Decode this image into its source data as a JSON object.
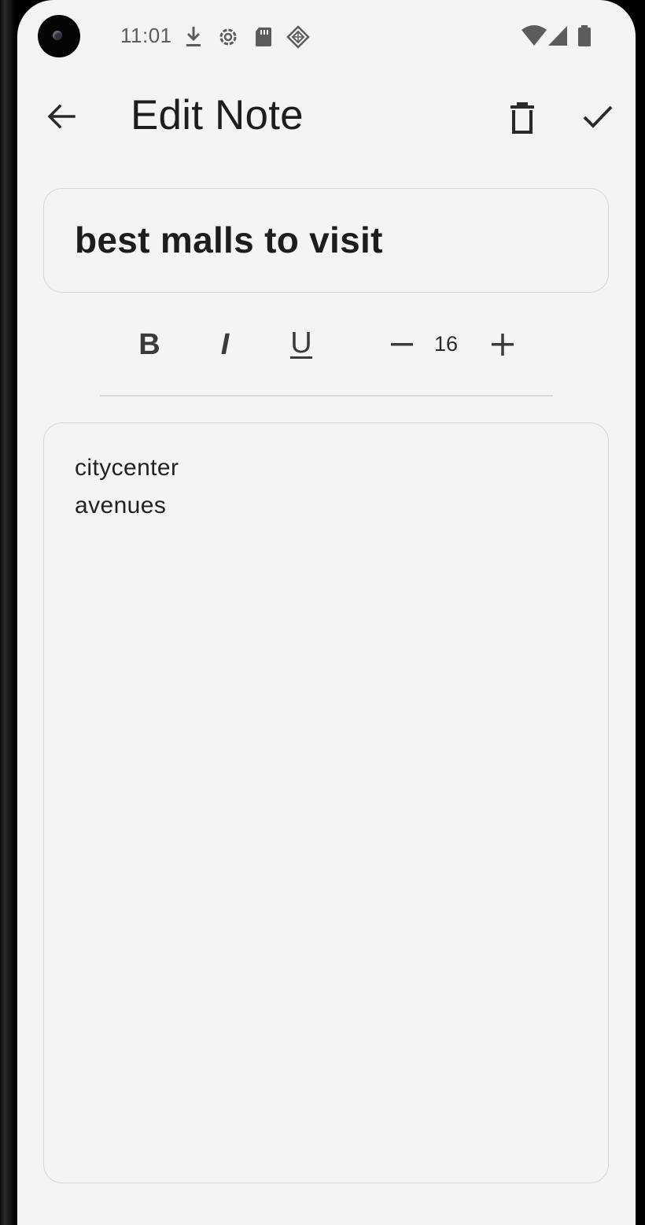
{
  "status_bar": {
    "time": "11:01",
    "notification_icons": [
      "download-icon",
      "settings-gear-icon",
      "sd-card-icon",
      "app-diamond-icon"
    ],
    "system_icons": [
      "wifi-icon",
      "cellular-signal-icon",
      "battery-icon"
    ]
  },
  "app_bar": {
    "title": "Edit Note",
    "back_icon": "arrow-back-icon",
    "delete_icon": "delete-icon",
    "save_icon": "check-icon"
  },
  "note": {
    "title": "best malls to visit",
    "body_lines": [
      "citycenter",
      "avenues"
    ]
  },
  "formatting": {
    "bold_label": "B",
    "italic_label": "I",
    "underline_label": "U",
    "font_size": "16"
  },
  "colors": {
    "background": "#f4f4f4",
    "text": "#1d1d1f",
    "border": "#d6d6d6",
    "icon": "#3b3b3b"
  }
}
